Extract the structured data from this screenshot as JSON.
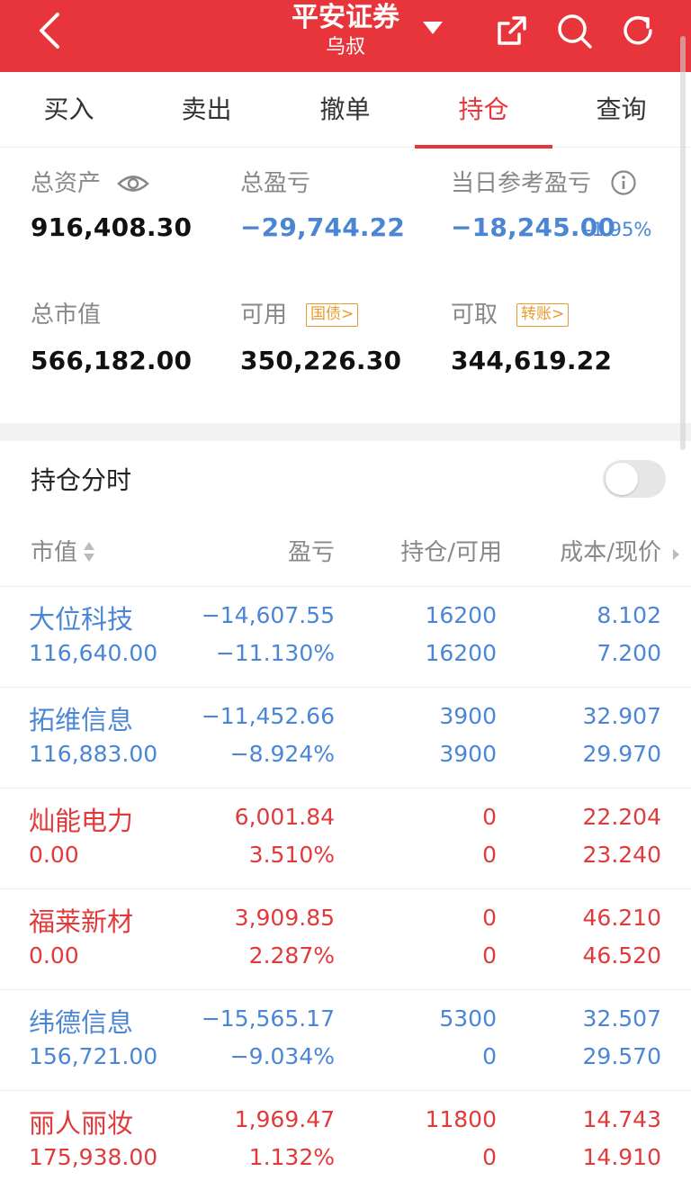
{
  "header": {
    "title": "平安证券",
    "subtitle": "乌叔",
    "bg_color": "#e8353b"
  },
  "tabs": [
    {
      "label": "买入",
      "active": false
    },
    {
      "label": "卖出",
      "active": false
    },
    {
      "label": "撤单",
      "active": false
    },
    {
      "label": "持仓",
      "active": true
    },
    {
      "label": "查询",
      "active": false
    }
  ],
  "summary": {
    "total_assets_label": "总资产",
    "total_assets": "916,408.30",
    "total_pnl_label": "总盈亏",
    "total_pnl": "−29,744.22",
    "daily_pnl_label": "当日参考盈亏",
    "daily_pnl": "−18,245.00",
    "daily_pnl_pct": "-1.95%",
    "market_value_label": "总市值",
    "market_value": "566,182.00",
    "available_label": "可用",
    "available_tag": "国债>",
    "available": "350,226.30",
    "withdrawable_label": "可取",
    "withdrawable_tag": "转账>",
    "withdrawable": "344,619.22"
  },
  "positions_section": {
    "title": "持仓分时",
    "toggle_on": false
  },
  "table": {
    "headers": [
      "市值",
      "盈亏",
      "持仓/可用",
      "成本/现价"
    ],
    "rows": [
      {
        "name": "大位科技",
        "market_value": "116,640.00",
        "pnl": "−14,607.55",
        "pnl_pct": "−11.130%",
        "position": "16200",
        "available": "16200",
        "cost": "8.102",
        "price": "7.200",
        "color": "blue"
      },
      {
        "name": "拓维信息",
        "market_value": "116,883.00",
        "pnl": "−11,452.66",
        "pnl_pct": "−8.924%",
        "position": "3900",
        "available": "3900",
        "cost": "32.907",
        "price": "29.970",
        "color": "blue"
      },
      {
        "name": "灿能电力",
        "market_value": "0.00",
        "pnl": "6,001.84",
        "pnl_pct": "3.510%",
        "position": "0",
        "available": "0",
        "cost": "22.204",
        "price": "23.240",
        "color": "red"
      },
      {
        "name": "福莱新材",
        "market_value": "0.00",
        "pnl": "3,909.85",
        "pnl_pct": "2.287%",
        "position": "0",
        "available": "0",
        "cost": "46.210",
        "price": "46.520",
        "color": "red"
      },
      {
        "name": "纬德信息",
        "market_value": "156,721.00",
        "pnl": "−15,565.17",
        "pnl_pct": "−9.034%",
        "position": "5300",
        "available": "0",
        "cost": "32.507",
        "price": "29.570",
        "color": "blue"
      },
      {
        "name": "丽人丽妆",
        "market_value": "175,938.00",
        "pnl": "1,969.47",
        "pnl_pct": "1.132%",
        "position": "11800",
        "available": "0",
        "cost": "14.743",
        "price": "14.910",
        "color": "red"
      }
    ]
  },
  "colors": {
    "accent": "#e8353b",
    "loss": "#4a86d4",
    "gain": "#e03a3a",
    "tag": "#e89a2c"
  }
}
